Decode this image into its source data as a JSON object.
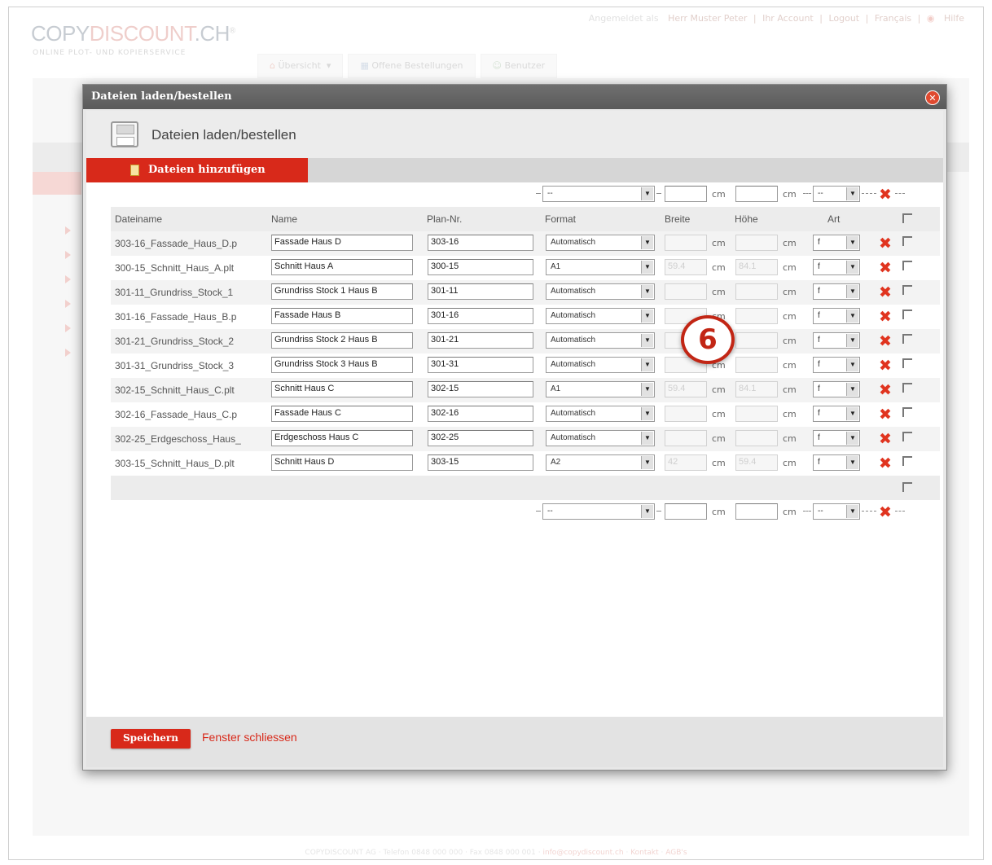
{
  "site": {
    "logo": {
      "part1": "COPY",
      "part2": "DISCOUNT",
      "part3": ".CH",
      "mark": "®",
      "tagline": "ONLINE PLOT- UND KOPIERSERVICE"
    },
    "topnav": {
      "logged_in_as": "Angemeldet als",
      "user": "Herr Muster Peter",
      "account": "Ihr Account",
      "logout": "Logout",
      "language": "Français",
      "help": "Hilfe"
    },
    "tabs": [
      "Übersicht",
      "Offene Bestellungen",
      "Benutzer"
    ],
    "footer": {
      "company": "COPYDISCOUNT AG",
      "phone": "Telefon 0848 000 000",
      "fax": "Fax 0848 000 001",
      "email": "info@copydiscount.ch",
      "contact": "Kontakt",
      "terms": "AGB's"
    }
  },
  "modal": {
    "title": "Dateien laden/bestellen",
    "heading": "Dateien laden/bestellen",
    "add_button": "Dateien hinzufügen",
    "save_button": "Speichern",
    "close_link": "Fenster schliessen",
    "callout": "6"
  },
  "table": {
    "headers": {
      "filename": "Dateiname",
      "name": "Name",
      "plan_nr": "Plan-Nr.",
      "format": "Format",
      "width": "Breite",
      "height": "Höhe",
      "type": "Art"
    },
    "unit": "cm",
    "top_format": "--",
    "top_type": "--",
    "bottom_format": "--",
    "bottom_type": "--",
    "rows": [
      {
        "filename": "303-16_Fassade_Haus_D.p",
        "name": "Fassade Haus D",
        "plan_nr": "303-16",
        "format": "Automatisch",
        "width": "",
        "height": "",
        "type": "f"
      },
      {
        "filename": "300-15_Schnitt_Haus_A.plt",
        "name": "Schnitt Haus A",
        "plan_nr": "300-15",
        "format": "A1",
        "width": "59.4",
        "height": "84.1",
        "type": "f"
      },
      {
        "filename": "301-11_Grundriss_Stock_1",
        "name": "Grundriss Stock 1 Haus B",
        "plan_nr": "301-11",
        "format": "Automatisch",
        "width": "",
        "height": "",
        "type": "f"
      },
      {
        "filename": "301-16_Fassade_Haus_B.p",
        "name": "Fassade Haus B",
        "plan_nr": "301-16",
        "format": "Automatisch",
        "width": "",
        "height": "",
        "type": "f"
      },
      {
        "filename": "301-21_Grundriss_Stock_2",
        "name": "Grundriss Stock 2 Haus B",
        "plan_nr": "301-21",
        "format": "Automatisch",
        "width": "",
        "height": "",
        "type": "f"
      },
      {
        "filename": "301-31_Grundriss_Stock_3",
        "name": "Grundriss Stock 3 Haus B",
        "plan_nr": "301-31",
        "format": "Automatisch",
        "width": "",
        "height": "",
        "type": "f"
      },
      {
        "filename": "302-15_Schnitt_Haus_C.plt",
        "name": "Schnitt Haus C",
        "plan_nr": "302-15",
        "format": "A1",
        "width": "59.4",
        "height": "84.1",
        "type": "f"
      },
      {
        "filename": "302-16_Fassade_Haus_C.p",
        "name": "Fassade Haus C",
        "plan_nr": "302-16",
        "format": "Automatisch",
        "width": "",
        "height": "",
        "type": "f"
      },
      {
        "filename": "302-25_Erdgeschoss_Haus_",
        "name": "Erdgeschoss Haus C",
        "plan_nr": "302-25",
        "format": "Automatisch",
        "width": "",
        "height": "",
        "type": "f"
      },
      {
        "filename": "303-15_Schnitt_Haus_D.plt",
        "name": "Schnitt Haus D",
        "plan_nr": "303-15",
        "format": "A2",
        "width": "42",
        "height": "59.4",
        "type": "f"
      }
    ]
  },
  "colors": {
    "accent": "#d8291a",
    "title_bar": "#626262",
    "row_alt": "#f3f3f3"
  }
}
